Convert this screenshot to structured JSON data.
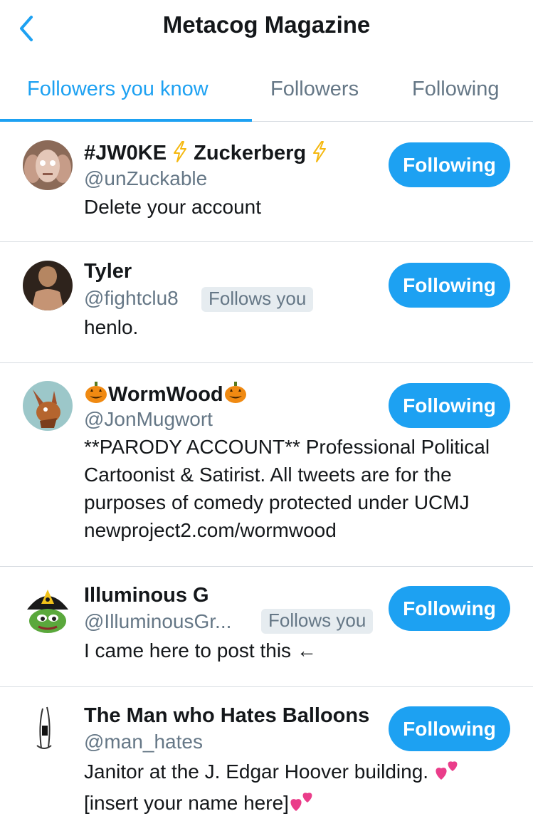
{
  "header": {
    "title": "Metacog Magazine"
  },
  "tabs": [
    {
      "label": "Followers you know"
    },
    {
      "label": "Followers"
    },
    {
      "label": "Following"
    }
  ],
  "colors": {
    "accent": "#1da1f2",
    "secondary_text": "#657786",
    "divider": "#d8dde2"
  },
  "users": [
    {
      "name_a": "#JW0KE",
      "name_b": "Zuckerberg",
      "handle": "@unZuckable",
      "bio": "Delete your account",
      "button": "Following",
      "name_icon": "lightning-icon"
    },
    {
      "name": "Tyler",
      "handle": "@fightclu8",
      "badge": "Follows you",
      "bio": "henlo.",
      "button": "Following"
    },
    {
      "name": "WormWood",
      "handle": "@JonMugwort",
      "bio": "**PARODY ACCOUNT** Professional Political Cartoonist & Satirist. All tweets are for the purposes of comedy protected under UCMJ newproject2.com/wormwood",
      "button": "Following",
      "name_icon": "jack-o-lantern-icon"
    },
    {
      "name": "Illuminous G",
      "handle": "@IlluminousGr...",
      "badge": "Follows you",
      "bio": "I came here to post this ←",
      "button": "Following"
    },
    {
      "name": "The Man who Hates Balloons",
      "handle": "@man_hates",
      "bio_line1": "Janitor at the J. Edgar Hoover building.",
      "bio_line2": "[insert your name here]",
      "button": "Following",
      "bio_icon": "two-hearts-icon"
    }
  ]
}
